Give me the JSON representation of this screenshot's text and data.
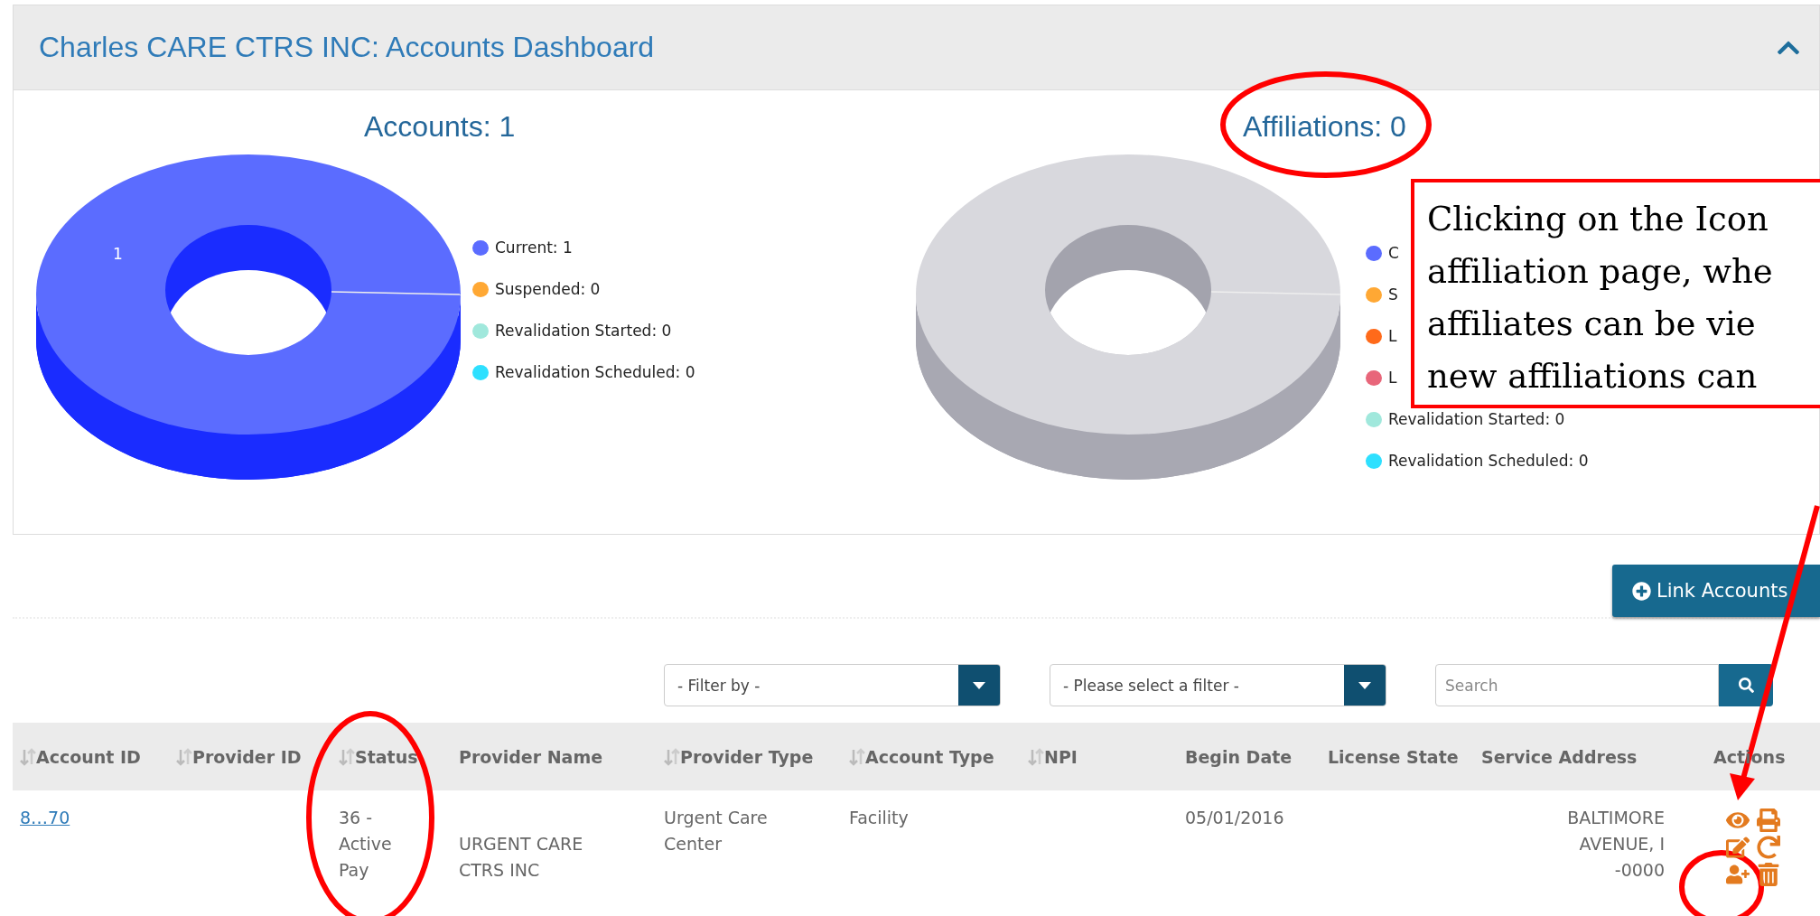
{
  "panel": {
    "title": "Charles CARE CTRS INC: Accounts Dashboard",
    "expanded": true
  },
  "charts": [
    {
      "title": "Accounts: 1",
      "color": "#5b6cff",
      "data_label": "1",
      "legend": [
        {
          "label": "Current: 1",
          "color": "#5b6cff"
        },
        {
          "label": "Suspended: 0",
          "color": "#ffa834"
        },
        {
          "label": "Revalidation Started: 0",
          "color": "#a0e8dc"
        },
        {
          "label": "Revalidation Scheduled: 0",
          "color": "#2ee0ff"
        }
      ]
    },
    {
      "title": "Affiliations: 0",
      "color": "#d8d8dd",
      "legend": [
        {
          "label": "C",
          "color": "#5b6cff"
        },
        {
          "label": "S",
          "color": "#ffa834"
        },
        {
          "label": "L",
          "color": "#ff6a1a"
        },
        {
          "label": "L",
          "color": "#e8667a"
        },
        {
          "label": "Revalidation Started: 0",
          "color": "#a0e8dc"
        },
        {
          "label": "Revalidation Scheduled: 0",
          "color": "#2ee0ff"
        }
      ]
    }
  ],
  "link_button": "Link Accounts",
  "filters": [
    {
      "value": "- Filter by -"
    },
    {
      "value": "- Please select a filter -"
    }
  ],
  "search": {
    "placeholder": "Search"
  },
  "table": {
    "columns": [
      {
        "label": "Account ID",
        "sortable": true
      },
      {
        "label": "Provider ID",
        "sortable": true
      },
      {
        "label": "Status",
        "sortable": true
      },
      {
        "label": "Provider Name",
        "sortable": false
      },
      {
        "label": "Provider Type",
        "sortable": true
      },
      {
        "label": "Account Type",
        "sortable": true
      },
      {
        "label": "NPI",
        "sortable": true
      },
      {
        "label": "Begin Date",
        "sortable": false
      },
      {
        "label": "License State",
        "sortable": false
      },
      {
        "label": "Service Address",
        "sortable": false
      },
      {
        "label": "Actions",
        "sortable": false
      }
    ],
    "rows": [
      {
        "cells": [
          {
            "kind": "link",
            "text": "8…70"
          },
          {
            "kind": "empty"
          },
          {
            "kind": "text",
            "text": "36 - Active Pay"
          },
          {
            "kind": "text",
            "text": "URGENT CARE CTRS INC"
          },
          {
            "kind": "text",
            "text": "Urgent Care Center"
          },
          {
            "kind": "text",
            "text": "Facility"
          },
          {
            "kind": "empty"
          },
          {
            "kind": "text",
            "text": "05/01/2016"
          },
          {
            "kind": "empty"
          },
          {
            "kind": "address",
            "lines": [
              "BALTIMORE",
              "AVENUE, I",
              "-0000"
            ]
          },
          {
            "kind": "actions"
          }
        ]
      }
    ]
  },
  "annotation": {
    "lines": [
      "Clicking on the Icon",
      "affiliation page, whe",
      "affiliates can be vie",
      "new affiliations can"
    ]
  }
}
